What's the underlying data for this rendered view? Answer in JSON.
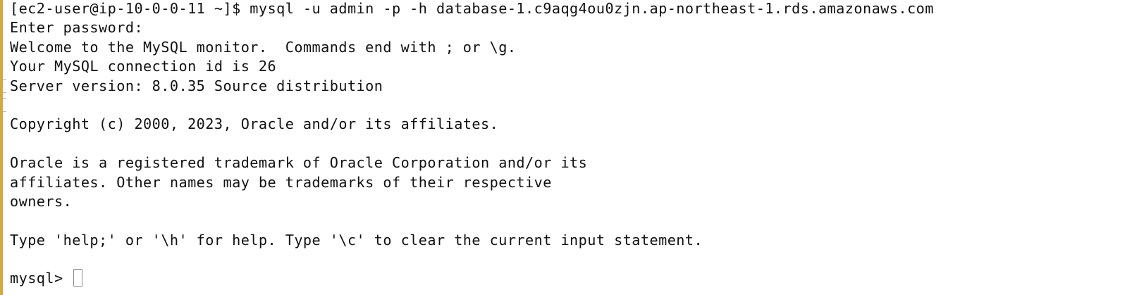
{
  "terminal": {
    "lines": [
      "[ec2-user@ip-10-0-0-11 ~]$ mysql -u admin -p -h database-1.c9aqg4ou0zjn.ap-northeast-1.rds.amazonaws.com",
      "Enter password:",
      "Welcome to the MySQL monitor.  Commands end with ; or \\g.",
      "Your MySQL connection id is 26",
      "Server version: 8.0.35 Source distribution",
      "",
      "Copyright (c) 2000, 2023, Oracle and/or its affiliates.",
      "",
      "Oracle is a registered trademark of Oracle Corporation and/or its",
      "affiliates. Other names may be trademarks of their respective",
      "owners.",
      "",
      "Type 'help;' or '\\h' for help. Type '\\c' to clear the current input statement.",
      ""
    ],
    "prompt": "mysql> "
  }
}
